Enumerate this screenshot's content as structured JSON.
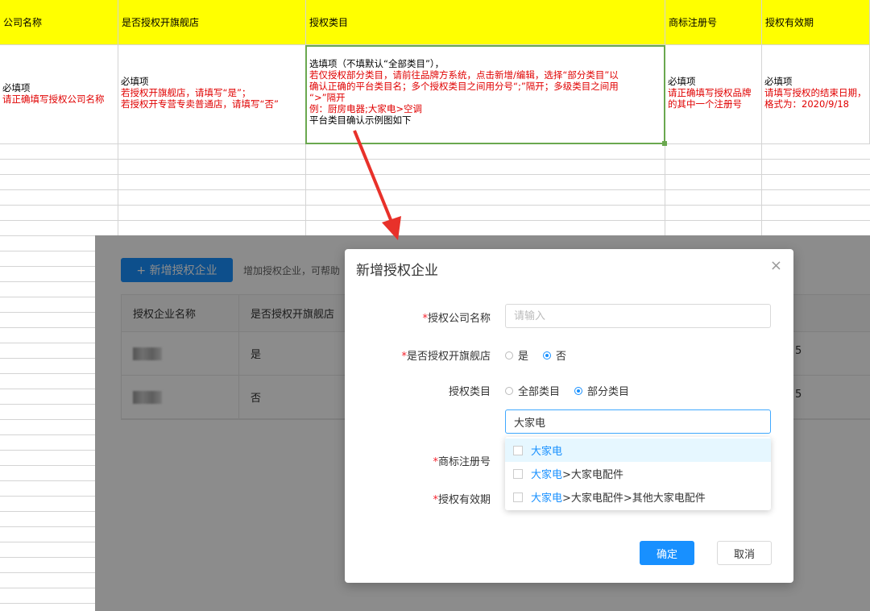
{
  "sheet": {
    "headers": [
      "公司名称",
      "是否授权开旗舰店",
      "授权类目",
      "商标注册号",
      "授权有效期"
    ],
    "row2": {
      "col1": [
        "必填项",
        "请正确填写授权公司名称"
      ],
      "col2": [
        "必填项",
        "若授权开旗舰店，请填写“是”；",
        "若授权开专营专卖普通店，请填写“否”"
      ],
      "col3": [
        "选填项（不填默认“全部类目”），",
        "若仅授权部分类目，请前往品牌方系统，点击新增/编辑，选择“部分类目”以",
        "确认正确的平台类目名；多个授权类目之间用分号“;”隔开；多级类目之间用",
        "“>”隔开",
        "例：厨房电器;大家电>空调",
        "平台类目确认示例图如下"
      ],
      "col4": [
        "必填项",
        "请正确填写授权品牌",
        "的其中一个注册号"
      ],
      "col5": [
        "必填项",
        "请填写授权的结束日期，",
        "格式为：2020/9/18"
      ]
    }
  },
  "app": {
    "add_button": "+ 新增授权企业",
    "add_hint": "增加授权企业，可帮助",
    "table": {
      "headers": [
        "授权企业名称",
        "是否授权开旗舰店"
      ],
      "rows": [
        {
          "flagship": "是",
          "tail": "5"
        },
        {
          "flagship": "否",
          "tail": "5"
        }
      ]
    }
  },
  "modal": {
    "title": "新增授权企业",
    "close": "×",
    "fields": {
      "company_label": "授权公司名称",
      "company_placeholder": "请输入",
      "flagship_label": "是否授权开旗舰店",
      "flagship_yes": "是",
      "flagship_no": "否",
      "category_label": "授权类目",
      "category_all": "全部类目",
      "category_part": "部分类目",
      "category_search_value": "大家电",
      "trademark_label": "商标注册号",
      "validity_label": "授权有效期"
    },
    "dropdown": [
      {
        "match": "大家电",
        "rest": ""
      },
      {
        "match": "大家电",
        "rest": ">大家电配件"
      },
      {
        "match": "大家电",
        "rest": ">大家电配件>其他大家电配件"
      }
    ],
    "ok": "确定",
    "cancel": "取消",
    "required_mark": "*"
  },
  "colors": {
    "header_yellow": "#ffff00",
    "required_red": "#e00000",
    "primary_blue": "#1890ff",
    "arrow_red": "#e8312a",
    "selection_green": "#6aa84f"
  }
}
